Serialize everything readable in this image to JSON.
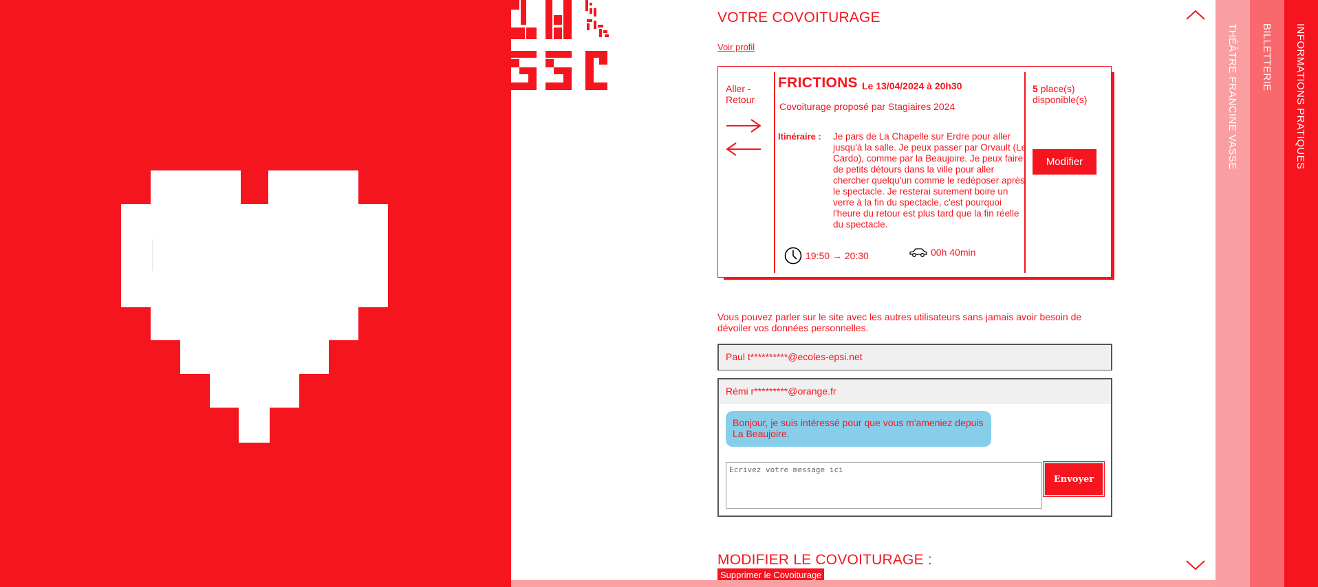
{
  "brand": {
    "accent": "#f5151f",
    "bubble": "#87ceeb"
  },
  "header": {
    "title": "VOTRE COVOITURAGE",
    "profile_link": "Voir profil"
  },
  "card": {
    "direction": "Aller - Retour",
    "show_title": "FRICTIONS",
    "show_date": "Le 13/04/2024 à 20h30",
    "proposer": "Covoiturage proposé par Stagiaires 2024",
    "itinerary_label": "Itinéraire :",
    "itinerary_text": "Je pars de La Chapelle sur Erdre pour aller jusqu'à la salle. Je peux passer par Orvault (Le Cardo), comme par la Beaujoire. Je peux faire de petits détours dans la ville pour aller chercher quelqu'un comme le redéposer après le spectacle. Je resterai surement boire un verre à la fin du spectacle, c'est pourquoi l'heure du retour est plus tard que la fin réelle du spectacle.",
    "times": "19:50 → 20:30",
    "duration": "00h 40min",
    "places_count": "5",
    "places_label": "place(s) disponible(s)",
    "modify_label": "Modifier"
  },
  "info_text": "Vous pouvez parler sur le site avec les autres utilisateurs sans jamais avoir besoin de dévoiler vos données personnelles.",
  "threads": [
    {
      "contact": "Paul t**********@ecoles-epsi.net"
    },
    {
      "contact": "Rémi r*********@orange.fr",
      "messages": [
        {
          "text": "Bonjour, je suis intéressé pour que vous m'ameniez depuis La Beaujoire."
        }
      ],
      "input_placeholder": "Ecrivez votre message ici",
      "send_label": "Envoyer"
    }
  ],
  "edit_section": {
    "title": "MODIFIER LE COVOITURAGE :",
    "delete_label": "Supprimer le Covoiturage"
  },
  "side_tabs": [
    {
      "label": "THÉÂTRE FRANCINE VASSE"
    },
    {
      "label": "BILLETTERIE"
    },
    {
      "label": "INFORMATIONS PRATIQUES"
    }
  ],
  "icons": [
    "heart-logo",
    "clock-icon",
    "car-icon",
    "arrow-right-icon",
    "arrow-left-icon",
    "chevron-up-icon",
    "chevron-down-icon"
  ]
}
